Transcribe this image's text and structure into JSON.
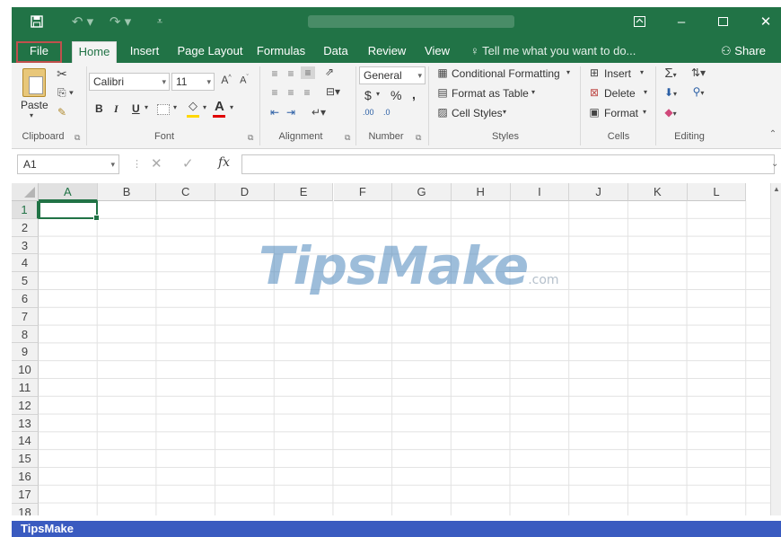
{
  "titlebar": {
    "save_icon": "save-icon",
    "undo_icon": "undo-icon",
    "redo_icon": "redo-icon",
    "ribbon_display_icon": "ribbon-display-options-icon",
    "minimize_icon": "minimize-icon",
    "maximize_icon": "maximize-icon",
    "close_icon": "close-icon"
  },
  "tabs": [
    {
      "label": "File"
    },
    {
      "label": "Home"
    },
    {
      "label": "Insert"
    },
    {
      "label": "Page Layout"
    },
    {
      "label": "Formulas"
    },
    {
      "label": "Data"
    },
    {
      "label": "Review"
    },
    {
      "label": "View"
    }
  ],
  "tell_me": "Tell me what you want to do...",
  "share": "Share",
  "ribbon": {
    "clipboard": {
      "paste": "Paste",
      "label": "Clipboard"
    },
    "font": {
      "name": "Calibri",
      "size": "11",
      "bold": "B",
      "italic": "I",
      "underline": "U",
      "label": "Font"
    },
    "alignment": {
      "label": "Alignment"
    },
    "number": {
      "format": "General",
      "currency": "$",
      "percent": "%",
      "comma": ",",
      "inc_decimal": ".00",
      "dec_decimal": ".0",
      "label": "Number"
    },
    "styles": {
      "conditional": "Conditional Formatting",
      "format_table": "Format as Table",
      "cell_styles": "Cell Styles",
      "label": "Styles"
    },
    "cells": {
      "insert": "Insert",
      "delete": "Delete",
      "format": "Format",
      "label": "Cells"
    },
    "editing": {
      "label": "Editing"
    }
  },
  "formula_bar": {
    "name_box": "A1",
    "fx": "fx",
    "value": ""
  },
  "grid": {
    "columns": [
      "A",
      "B",
      "C",
      "D",
      "E",
      "F",
      "G",
      "H",
      "I",
      "J",
      "K",
      "L"
    ],
    "rows": [
      "1",
      "2",
      "3",
      "4",
      "5",
      "6",
      "7",
      "8",
      "9",
      "10",
      "11",
      "12",
      "13",
      "14",
      "15",
      "16",
      "17",
      "18"
    ],
    "selected_cell": "A1"
  },
  "watermark": {
    "main": "TipsMake",
    "suffix": ".com"
  },
  "banner": "TipsMake",
  "colors": {
    "excel_green": "#217346",
    "banner_blue": "#3a5bc0",
    "file_outline": "#c0504d"
  }
}
